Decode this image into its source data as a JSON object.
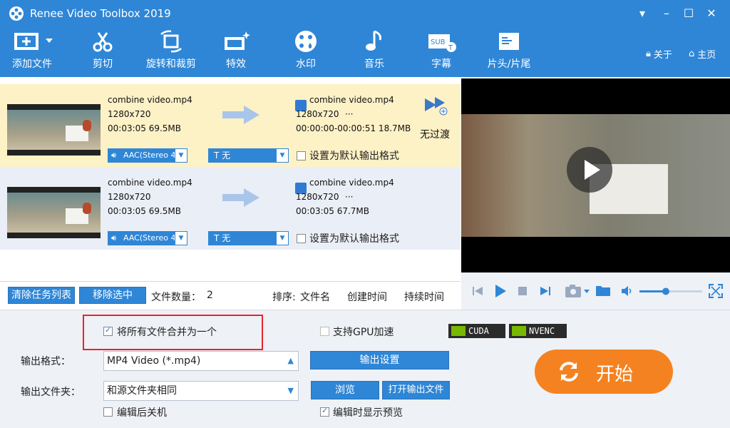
{
  "app": {
    "title": "Renee Video Toolbox 2019"
  },
  "toolbar": {
    "items": [
      {
        "label": "添加文件",
        "icon": "add-file-icon"
      },
      {
        "label": "剪切",
        "icon": "scissors-icon"
      },
      {
        "label": "旋转和裁剪",
        "icon": "crop-rotate-icon"
      },
      {
        "label": "特效",
        "icon": "effects-icon"
      },
      {
        "label": "水印",
        "icon": "watermark-icon"
      },
      {
        "label": "音乐",
        "icon": "music-icon"
      },
      {
        "label": "字幕",
        "icon": "subtitle-icon"
      },
      {
        "label": "片头/片尾",
        "icon": "intro-outro-icon"
      }
    ],
    "about": "关于",
    "home": "主页"
  },
  "files": [
    {
      "name": "combine video.mp4",
      "resolution": "1280x720",
      "duration_size": "00:03:05  69.5MB",
      "out_name": "combine video.mp4",
      "out_resolution": "1280x720",
      "out_extra": "···",
      "out_duration_size": "00:00:00-00:00:51  18.7MB",
      "audio": "AAC(Stereo 4",
      "subtitle": "T 无",
      "default_label": "设置为默认输出格式",
      "transition": "无过渡"
    },
    {
      "name": "combine video.mp4",
      "resolution": "1280x720",
      "duration_size": "00:03:05  69.5MB",
      "out_name": "combine video.mp4",
      "out_resolution": "1280x720",
      "out_extra": "···",
      "out_duration_size": "00:03:05  67.7MB",
      "audio": "AAC(Stereo 4",
      "subtitle": "T 无",
      "default_label": "设置为默认输出格式"
    }
  ],
  "listbar": {
    "clear": "清除任务列表",
    "remove": "移除选中",
    "count_label": "文件数量：",
    "count": "2",
    "sort_label": "排序:",
    "sort_name": "文件名",
    "sort_created": "创建时间",
    "sort_duration": "持续时间"
  },
  "settings": {
    "merge_label": "将所有文件合并为一个",
    "merge_checked": true,
    "gpu_label": "支持GPU加速",
    "gpu_checked": false,
    "cuda": "CUDA",
    "nvenc": "NVENC",
    "format_label": "输出格式：",
    "format_value": "MP4 Video (*.mp4)",
    "output_settings": "输出设置",
    "folder_label": "输出文件夹：",
    "folder_value": "和源文件夹相同",
    "browse": "浏览",
    "open_folder": "打开输出文件",
    "shutdown_label": "编辑后关机",
    "shutdown_checked": false,
    "preview_label": "编辑时显示预览",
    "preview_checked": true,
    "start": "开始"
  },
  "colors": {
    "accent": "#2f86d6",
    "start": "#f58220",
    "selected_row": "#fdf1c6"
  },
  "player": {
    "volume_fraction": 0.42
  }
}
